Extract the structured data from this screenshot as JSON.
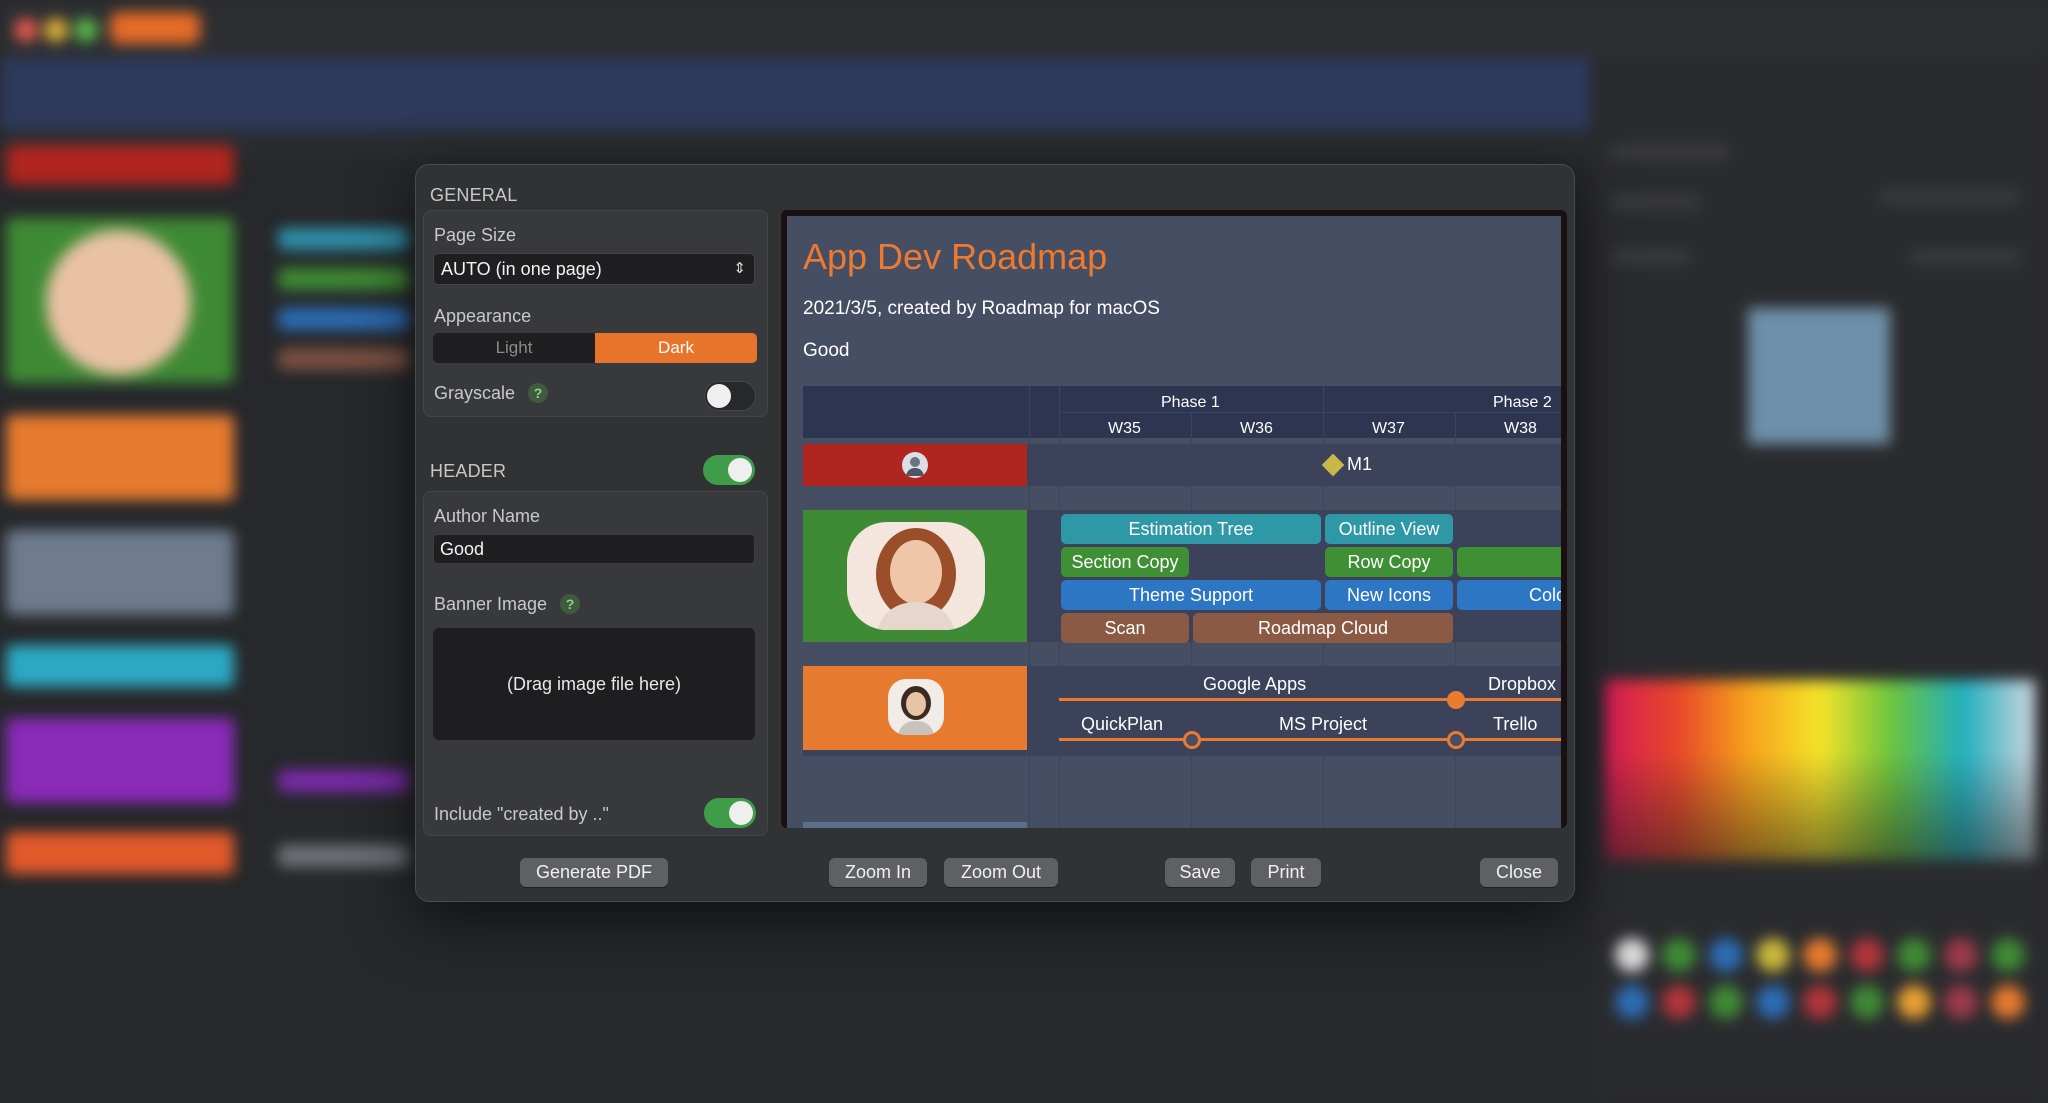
{
  "dialog": {
    "general_title": "GENERAL",
    "page_size_label": "Page Size",
    "page_size_value": "AUTO (in one page)",
    "appearance_label": "Appearance",
    "appearance_options": [
      "Light",
      "Dark"
    ],
    "appearance_selected": "Dark",
    "grayscale_label": "Grayscale",
    "grayscale_on": false,
    "help_glyph": "?",
    "header_title": "HEADER",
    "header_on": true,
    "author_name_label": "Author Name",
    "author_name_value": "Good",
    "banner_image_label": "Banner Image",
    "banner_drop_text": "(Drag image file here)",
    "include_created_label": "Include \"created by ..\"",
    "include_created_on": true,
    "buttons": {
      "generate_pdf": "Generate PDF",
      "zoom_in": "Zoom In",
      "zoom_out": "Zoom Out",
      "save": "Save",
      "print": "Print",
      "close": "Close"
    }
  },
  "preview": {
    "title": "App Dev Roadmap",
    "subtitle": "2021/3/5, created by Roadmap for macOS",
    "author": "Good",
    "phases": [
      "Phase 1",
      "Phase 2"
    ],
    "weeks": [
      "W35",
      "W36",
      "W37",
      "W38"
    ],
    "milestone": "M1",
    "tasks": {
      "estimation_tree": "Estimation Tree",
      "outline_view": "Outline View",
      "section_copy": "Section Copy",
      "row_copy": "Row Copy",
      "theme_support": "Theme Support",
      "new_icons": "New Icons",
      "colo": "Colo",
      "scan": "Scan",
      "roadmap_cloud": "Roadmap Cloud"
    },
    "milestones_row1": [
      "Google Apps",
      "Dropbox"
    ],
    "milestones_row2": [
      "QuickPlan",
      "MS Project",
      "Trello"
    ]
  },
  "colors": {
    "accent_orange": "#e8742c",
    "toggle_green": "#3f9d4a",
    "lane_red": "#b0251f",
    "lane_green": "#3f8a35",
    "lane_orange": "#e67a2e"
  }
}
